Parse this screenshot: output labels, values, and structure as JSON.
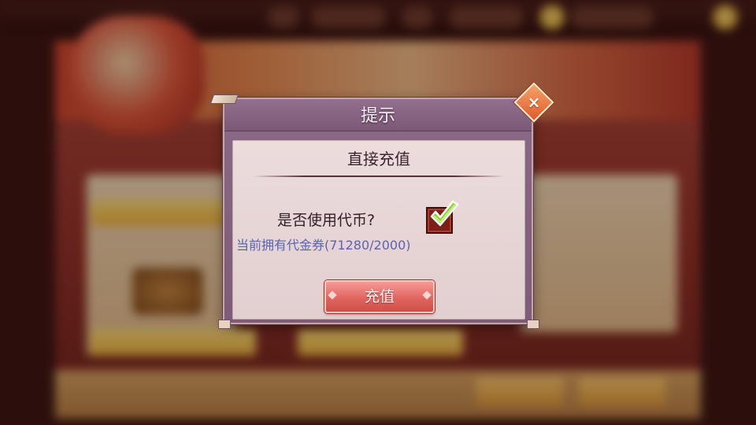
{
  "dialog": {
    "title": "提示",
    "subtitle": "直接充值",
    "question": "是否使用代币?",
    "use_token_checked": true,
    "balance_text": "当前拥有代金券(71280/2000)",
    "recharge_label": "充值",
    "close_glyph": "×"
  },
  "colors": {
    "dialog_frame": "#7d5b79",
    "content_bg": "#ecdcdc",
    "balance_text": "#5a63b3",
    "recharge_button": "#e0655f",
    "close_button": "#df5b2b",
    "checkbox_bg": "#7c1f18",
    "checkmark": "#8fd13a"
  },
  "icons": {
    "close": "close-icon",
    "check": "checkmark-icon"
  }
}
